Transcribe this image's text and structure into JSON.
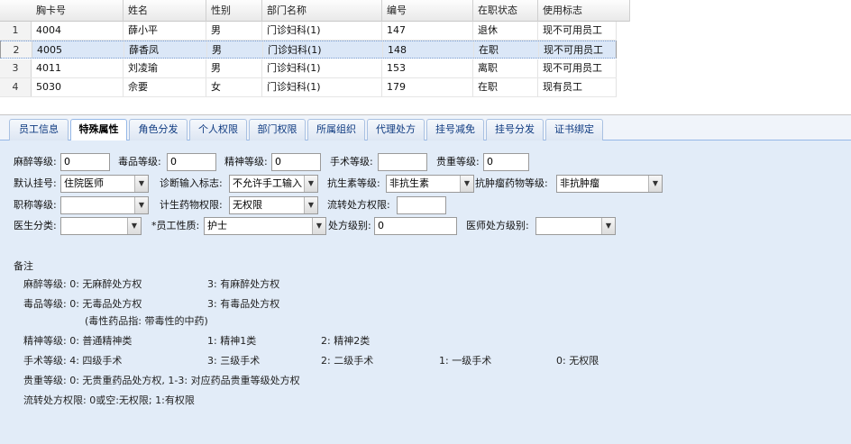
{
  "grid": {
    "columns": [
      "胸卡号",
      "姓名",
      "性别",
      "部门名称",
      "编号",
      "在职状态",
      "使用标志"
    ],
    "rows": [
      {
        "num": "1",
        "cells": [
          "4004",
          "薛小平",
          "男",
          "门诊妇科(1)",
          "147",
          "退休",
          "现不可用员工"
        ]
      },
      {
        "num": "2",
        "cells": [
          "4005",
          "薛香凤",
          "男",
          "门诊妇科(1)",
          "148",
          "在职",
          "现不可用员工"
        ]
      },
      {
        "num": "3",
        "cells": [
          "4011",
          "刘凌瑜",
          "男",
          "门诊妇科(1)",
          "153",
          "离职",
          "现不可用员工"
        ]
      },
      {
        "num": "4",
        "cells": [
          "5030",
          "佘要",
          "女",
          "门诊妇科(1)",
          "179",
          "在职",
          "现有员工"
        ]
      }
    ]
  },
  "tabs": [
    "员工信息",
    "特殊属性",
    "角色分发",
    "个人权限",
    "部门权限",
    "所属组织",
    "代理处方",
    "挂号减免",
    "挂号分发",
    "证书绑定"
  ],
  "form": {
    "row1": {
      "mazui_label": "麻醉等级:",
      "mazui_value": "0",
      "dupin_label": "毒品等级:",
      "dupin_value": "0",
      "jingshen_label": "精神等级:",
      "jingshen_value": "0",
      "shoushu_label": "手术等级:",
      "shoushu_value": "",
      "guizhong_label": "贵重等级:",
      "guizhong_value": "0"
    },
    "row2": {
      "guahao_label": "默认挂号:",
      "guahao_value": "住院医师",
      "zhenduan_label": "诊断输入标志:",
      "zhenduan_value": "不允许手工输入",
      "kangjun_label": "抗生素等级:",
      "kangjun_value": "非抗生素",
      "kangzhong_label": "抗肿瘤药物等级:",
      "kangzhong_value": "非抗肿瘤"
    },
    "row3": {
      "zhicheng_label": "职称等级:",
      "zhicheng_value": "",
      "jisheng_label": "计生药物权限:",
      "jisheng_value": "无权限",
      "liuzhuan_label": "流转处方权限:",
      "liuzhuan_value": ""
    },
    "row4": {
      "yisheng_label": "医生分类:",
      "yisheng_value": "",
      "xingzhi_label": "*员工性质:",
      "xingzhi_value": "护士",
      "chufang_label": "处方级别:",
      "chufang_value": "0",
      "yishichufang_label": "医师处方级别:",
      "yishichufang_value": ""
    }
  },
  "notes": {
    "title": "备注",
    "l1a": "麻醉等级:  0: 无麻醉处方权",
    "l1b": "3: 有麻醉处方权",
    "l2a": "毒品等级:  0: 无毒品处方权",
    "l2b": "3: 有毒品处方权",
    "l3": "(毒性药品指: 带毒性的中药)",
    "l4a": "精神等级:  0: 普通精神类",
    "l4b": "1: 精神1类",
    "l4c": "2: 精神2类",
    "l5a": "手术等级:  4: 四级手术",
    "l5b": "3: 三级手术",
    "l5c": "2: 二级手术",
    "l5d": "1: 一级手术",
    "l5e": "0: 无权限",
    "l6": "贵重等级:  0: 无贵重药品处方权, 1-3: 对应药品贵重等级处方权",
    "l7": "流转处方权限: 0或空:无权限; 1:有权限"
  }
}
